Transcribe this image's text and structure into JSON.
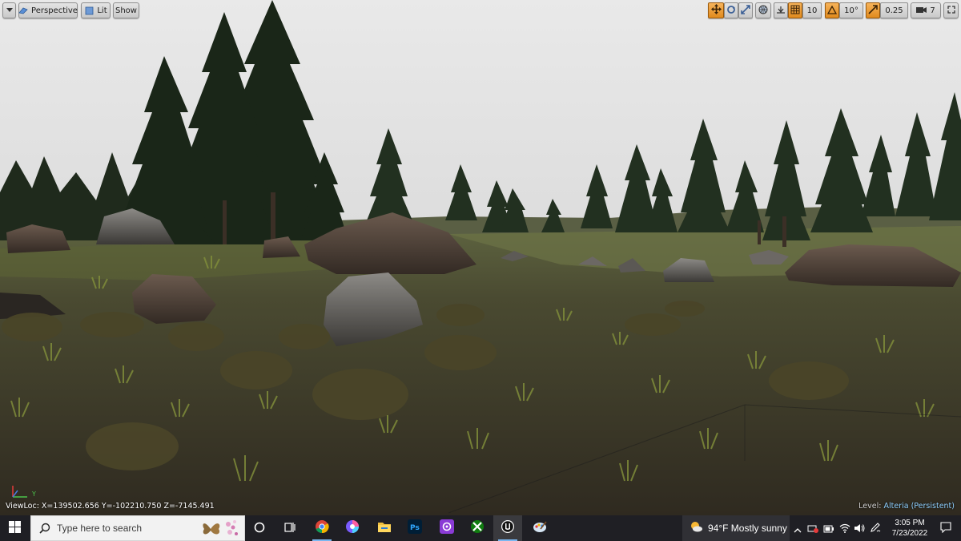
{
  "viewport_toolbar": {
    "perspective_label": "Perspective",
    "lit_label": "Lit",
    "show_label": "Show",
    "grid_snap_value": "10",
    "rotation_snap_value": "10°",
    "scale_snap_value": "0.25",
    "camera_speed_value": "7"
  },
  "status": {
    "viewloc": "ViewLoc: X=139502.656 Y=-102210.750 Z=-7145.491",
    "level_prefix": "Level:",
    "level_name": "Alteria (Persistent)",
    "axis_y": "Y"
  },
  "taskbar": {
    "search_placeholder": "Type here to search",
    "weather": "94°F  Mostly sunny",
    "time": "3:05 PM",
    "date": "7/23/2022",
    "apps": [
      "task-view",
      "chrome",
      "figma-color",
      "file-explorer",
      "photoshop",
      "creative-cloud",
      "xbox",
      "unreal-engine",
      "paint"
    ]
  },
  "colors": {
    "sky": "#e4e4e4",
    "ground": "#3d3a29",
    "toolbar_orange": "#e8952a",
    "taskbar": "#1f1f24",
    "level_name": "#8fd0ff"
  }
}
